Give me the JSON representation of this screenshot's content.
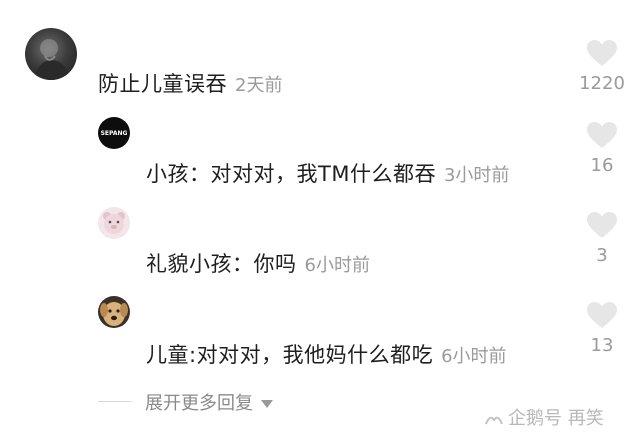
{
  "comments": [
    {
      "text": "防止儿童误吞",
      "time": "2天前",
      "likes": "1220",
      "avatar": "dark-portrait-avatar"
    },
    {
      "text": "小孩：对对对，我TM什么都吞",
      "time": "3小时前",
      "likes": "16",
      "avatar": "sepang-logo-avatar",
      "avatar_text": "SEPANG"
    },
    {
      "text": "礼貌小孩：你吗",
      "time": "6小时前",
      "likes": "3",
      "avatar": "bear-avatar"
    },
    {
      "text": "儿童:对对对，我他妈什么都吃",
      "time": "6小时前",
      "likes": "13",
      "avatar": "dog-avatar"
    }
  ],
  "expand": {
    "label": "展开更多回复"
  },
  "watermark": {
    "text": "企鹅号 再笑"
  },
  "colors": {
    "text": "#1f1f1f",
    "muted": "#9a9a9a",
    "heart": "#e6e6e6"
  }
}
